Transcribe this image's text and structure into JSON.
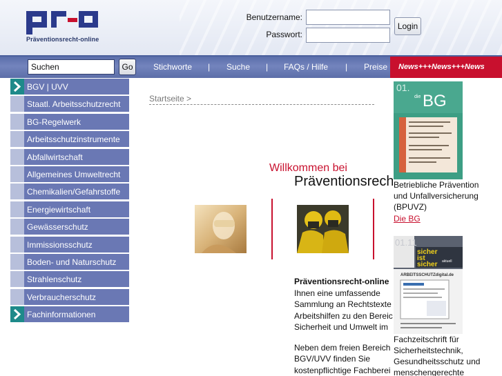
{
  "header": {
    "logo_text": "pro",
    "tagline": "Präventionsrecht-online",
    "username_label": "Benutzername:",
    "password_label": "Passwort:",
    "login_button": "Login"
  },
  "navbar": {
    "search_value": "Suchen",
    "go_button": "Go",
    "links": [
      "Stichworte",
      "Suche",
      "FAQs / Hilfe",
      "Preise"
    ],
    "separator": "|",
    "news": "News+++News+++News"
  },
  "sidebar": {
    "items": [
      {
        "label": "BGV | UVV",
        "arrow": true
      },
      {
        "label": "Staatl. Arbeitsschutzrecht",
        "arrow": false
      },
      {
        "label": "BG-Regelwerk",
        "arrow": false
      },
      {
        "label": "Arbeitsschutzinstrumente",
        "arrow": false
      },
      {
        "label": "Abfallwirtschaft",
        "arrow": false
      },
      {
        "label": "Allgemeines Umweltrecht",
        "arrow": false
      },
      {
        "label": "Chemikalien/Gefahrstoffe",
        "arrow": false
      },
      {
        "label": "Energiewirtschaft",
        "arrow": false
      },
      {
        "label": "Gewässerschutz",
        "arrow": false
      },
      {
        "label": "Immissionsschutz",
        "arrow": false
      },
      {
        "label": "Boden- und Naturschutz",
        "arrow": false
      },
      {
        "label": "Strahlenschutz",
        "arrow": false
      },
      {
        "label": "Verbraucherschutz",
        "arrow": false
      },
      {
        "label": "Fachinformationen",
        "arrow": true
      }
    ]
  },
  "main": {
    "breadcrumb": "Startseite >",
    "welcome": "Willkommen bei",
    "site_name": "Präventionsrecht-online",
    "intro": [
      "Präventionsrecht-online",
      "Ihnen eine umfassende",
      "Sammlung an Rechtstexte",
      "Arbeitshilfen zu den Bereic",
      "Sicherheit und Umwelt im",
      "",
      "Neben dem freien Bereich",
      "BGV/UVV finden Sie",
      "kostenpflichtige Fachberei"
    ]
  },
  "right": {
    "mag1": {
      "issue": "01.",
      "title": "BG",
      "tag": "die"
    },
    "mag1_caption": [
      "Betriebliche Prävention",
      "und Unfallversicherung",
      "(BPUVZ)"
    ],
    "mag1_link": "Die BG",
    "mag2": {
      "issue": "01.11",
      "title_lines": [
        "sicher",
        "ist",
        "sicher"
      ],
      "tag": "aktuell",
      "subtitle": "ARBEITSSCHUTZdigital.de"
    },
    "mag2_caption": [
      "Fachzeitschrift für",
      "Sicherheitstechnik,",
      "Gesundheitsschutz und",
      "menschengerechte"
    ]
  },
  "colors": {
    "nav_blue": "#6a78b4",
    "accent_red": "#c8102e",
    "arrow_teal": "#1e8a8a"
  }
}
